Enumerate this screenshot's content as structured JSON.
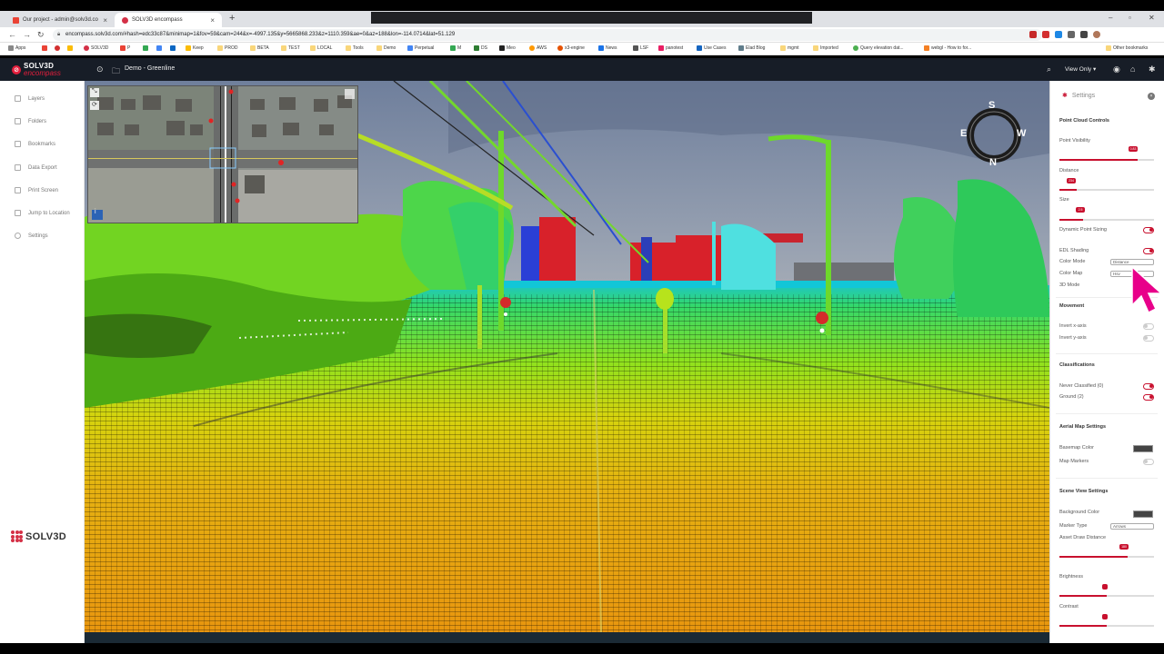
{
  "browser": {
    "tabs": [
      {
        "title": "Our project - admin@solv3d.co"
      },
      {
        "title": "SOLV3D encompass"
      }
    ],
    "url": "encompass.solv3d.com/#hash=edc33c87&minimap=1&fov=59&cam=244&x=-4997.135&y=5665868.233&z=1110.359&ae=0&az=188&lon=-114.0714&lat=51.129",
    "bookmarks": [
      "Apps",
      "",
      "",
      "",
      "SOLV3D",
      "P",
      "",
      "",
      "",
      "Keep",
      "PROD",
      "BETA",
      "TEST",
      "LOCAL",
      "Tools",
      "Demo",
      "Perpetual",
      "M",
      "DS",
      "Meo",
      "AWS",
      "x3-engine",
      "News",
      "LSF",
      "panotest",
      "Use Cases",
      "Elad Blog",
      "mgmt",
      "Imported",
      "Query elevation dat...",
      "webgl - How to for...",
      "Other bookmarks"
    ]
  },
  "app": {
    "brand_top": "SOLV3D",
    "brand_bottom": "encompass",
    "project": "Demo - Greenline",
    "view_mode": "View Only"
  },
  "sidebar": {
    "items": [
      {
        "label": "Layers"
      },
      {
        "label": "Folders"
      },
      {
        "label": "Bookmarks"
      },
      {
        "label": "Data Export"
      },
      {
        "label": "Print Screen"
      },
      {
        "label": "Jump to Location"
      },
      {
        "label": "Settings"
      }
    ],
    "footer_logo": "SOLV3D"
  },
  "compass": {
    "s": "S",
    "e": "E",
    "w": "W",
    "n": "N"
  },
  "settings": {
    "title": "Settings",
    "point_cloud": {
      "heading": "Point Cloud Controls",
      "point_visibility": {
        "label": "Point Visibility",
        "value": "0.83",
        "level": 0.83
      },
      "distance": {
        "label": "Distance",
        "value": "234",
        "level": 0.18
      },
      "size": {
        "label": "Size",
        "value": "2.5",
        "level": 0.25
      },
      "dynamic_point_sizing": "Dynamic Point Sizing",
      "edl_shading": "EDL Shading",
      "color_mode": {
        "label": "Color Mode",
        "value": "Distance"
      },
      "color_map": {
        "label": "Color Map",
        "value": "Hsv"
      },
      "mode_3d": "3D Mode"
    },
    "movement": {
      "heading": "Movement",
      "invert_x": "Invert x-axis",
      "invert_y": "Invert y-axis"
    },
    "classifications": {
      "heading": "Classifications",
      "never_classified": "Never Classified (0)",
      "ground": "Ground (2)"
    },
    "aerial": {
      "heading": "Aerial Map Settings",
      "basemap_color": "Basemap Color",
      "map_markers": "Map Markers"
    },
    "scene_view": {
      "heading": "Scene View Settings",
      "background_color": "Background Color",
      "marker_type": {
        "label": "Marker Type",
        "value": "Arrows"
      },
      "asset_draw_distance": {
        "label": "Asset Draw Distance",
        "value": "180",
        "level": 0.72
      },
      "brightness": {
        "label": "Brightness",
        "level": 0.5
      },
      "contrast": {
        "label": "Contrast",
        "level": 0.5
      }
    }
  },
  "colors": {
    "accent": "#c8102e",
    "appbar": "#171d27",
    "cursor": "#e8008a"
  }
}
